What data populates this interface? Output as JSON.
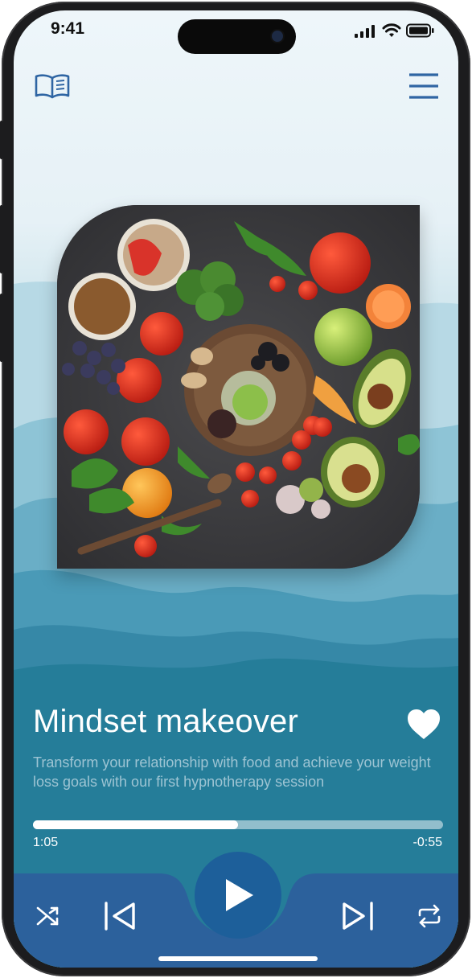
{
  "status_bar": {
    "time": "9:41"
  },
  "header": {
    "library_icon": "open-book-icon",
    "menu_icon": "hamburger-menu-icon"
  },
  "track": {
    "title": "Mindset makeover",
    "description": "Transform your relationship with food and achieve your weight loss goals with our first hypnotherapy session",
    "favorite_icon": "heart-icon",
    "artwork": "vegetables-bowl-artwork"
  },
  "playback": {
    "elapsed": "1:05",
    "remaining": "-0:55",
    "progress": 0.5
  },
  "controls": {
    "shuffle_icon": "shuffle-icon",
    "previous_icon": "skip-back-icon",
    "play_icon": "play-icon",
    "next_icon": "skip-forward-icon",
    "repeat_icon": "repeat-icon"
  },
  "colors": {
    "accent": "#1d5f9a",
    "nav": "#2f65a3",
    "teal": "#257d99"
  }
}
